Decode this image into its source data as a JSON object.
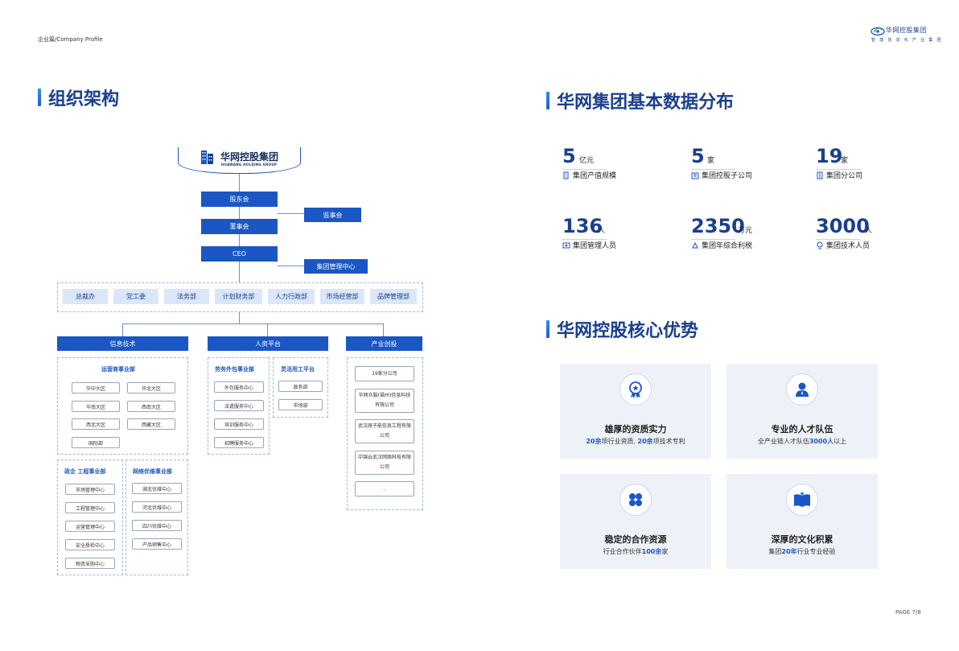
{
  "header": {
    "breadcrumb": "企业篇/Company Profile",
    "logo_name": "华网控股集团",
    "logo_tagline": "智 能 信 息 化 产 业 集 团"
  },
  "page_number": "PAGE 7/8",
  "org": {
    "title": "组织架构",
    "company_name": "华网控股集团",
    "company_en": "HUAWANG HOLDING GROUP",
    "shareholders": "股东会",
    "supervisors": "监事会",
    "board": "董事会",
    "ceo": "CEO",
    "group_mgmt": "集团管理中心",
    "departments": [
      "总裁办",
      "党工委",
      "法务部",
      "计划财务部",
      "人力行政部",
      "市场经营部",
      "品牌管理部"
    ],
    "divisions": {
      "it": {
        "label": "信息技术",
        "operator": {
          "title": "运营商事业部",
          "items": [
            "华中大区",
            "华北大区",
            "华南大区",
            "西南大区",
            "西北大区",
            "西藏大区",
            "国际部"
          ]
        },
        "gov": {
          "title": "政企 工程事业部",
          "items": [
            "市场管理中心",
            "工程管理中心",
            "运营管理中心",
            "安全质检中心",
            "物资采购中心"
          ]
        },
        "network": {
          "title": "网络优维事业部",
          "items": [
            "湖北优维中心",
            "河北优维中心",
            "四川优维中心",
            "产品销售中心"
          ]
        }
      },
      "hr": {
        "label": "人资平台",
        "outsourcing": {
          "title": "劳务外包事业部",
          "items": [
            "外包服务中心",
            "派遣服务中心",
            "培训服务中心",
            "招聘服务中心"
          ]
        },
        "flexible": {
          "title": "灵活用工平台",
          "items": [
            "政务部",
            "市场部"
          ]
        }
      },
      "industry": {
        "label": "产业创投",
        "items": [
          "19家分公司",
          "华网众服(福州)信息科技有限公司",
          "武汉原子能信息工程有限公司",
          "中锦云武汉网络科技有限公司",
          ".."
        ]
      }
    }
  },
  "stats": {
    "title": "华网集团基本数据分布",
    "items": [
      {
        "value": "5",
        "unit": "亿元",
        "label": "集团产值规模",
        "icon": "building-icon"
      },
      {
        "value": "5",
        "unit": "家",
        "label": "集团控股子公司",
        "icon": "company-icon"
      },
      {
        "value": "19",
        "unit": "家",
        "label": "集团分公司",
        "icon": "branch-icon"
      },
      {
        "value": "136",
        "unit": "人",
        "label": "集团管理人员",
        "icon": "manager-icon"
      },
      {
        "value": "2350",
        "unit": "万元",
        "label": "集团年综合利税",
        "icon": "tax-icon"
      },
      {
        "value": "3000",
        "unit": "人",
        "label": "集团技术人员",
        "icon": "tech-icon"
      }
    ]
  },
  "advantages": {
    "title": "华网控股核心优势",
    "cards": [
      {
        "title": "雄厚的资质实力",
        "desc_parts": [
          "20余",
          "项行业资质, ",
          "20余",
          "项技术专利"
        ],
        "icon": "award-icon"
      },
      {
        "title": "专业的人才队伍",
        "desc_parts": [
          "全产业链人才队伍",
          "3000人",
          "以上"
        ],
        "icon": "person-icon"
      },
      {
        "title": "稳定的合作资源",
        "desc_parts": [
          "行业合作伙伴",
          "100余",
          "家"
        ],
        "icon": "clover-icon"
      },
      {
        "title": "深厚的文化积累",
        "desc_parts": [
          "集团",
          "20年",
          "行业专业经验"
        ],
        "icon": "book-icon"
      }
    ]
  },
  "colors": {
    "primary": "#1a56c4",
    "title": "#1a3f8f",
    "card_bg": "#eef2f8"
  }
}
